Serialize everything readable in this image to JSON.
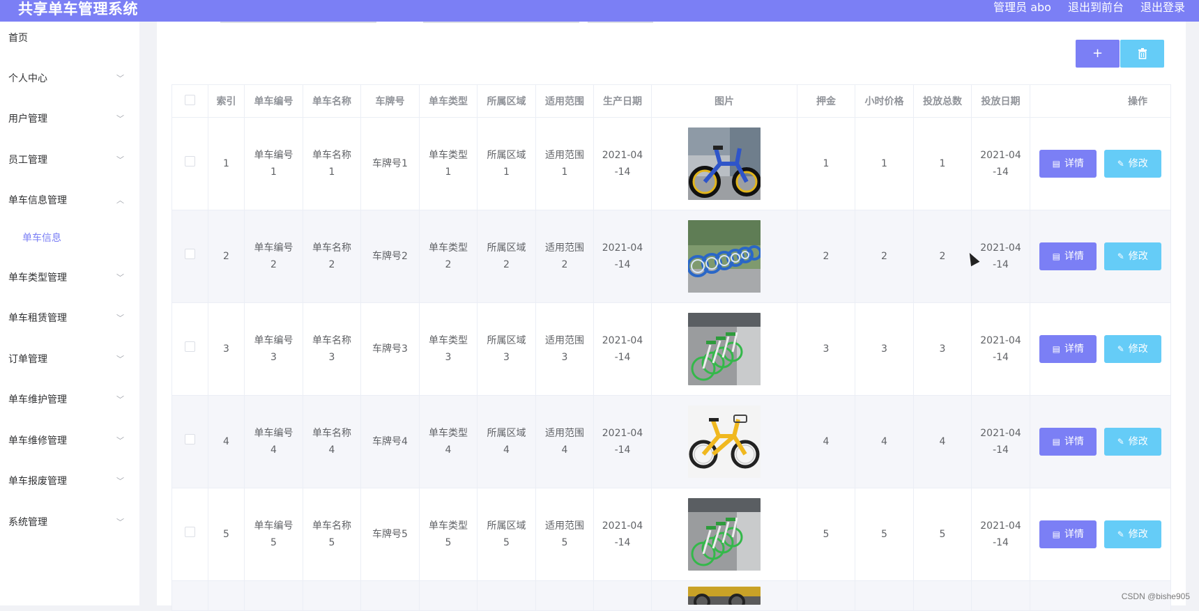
{
  "header": {
    "app_title": "共享单车管理系统",
    "user": "管理员 abo",
    "front_link": "退出到前台",
    "logout": "退出登录"
  },
  "sidebar": {
    "items": [
      {
        "label": "首页",
        "chevron": ""
      },
      {
        "label": "个人中心",
        "chevron": "chevron-down"
      },
      {
        "label": "用户管理",
        "chevron": "chevron-down"
      },
      {
        "label": "员工管理",
        "chevron": "chevron-down"
      },
      {
        "label": "单车信息管理",
        "chevron": "chevron-up"
      },
      {
        "label": "单车信息",
        "chevron": ""
      },
      {
        "label": "单车类型管理",
        "chevron": "chevron-down"
      },
      {
        "label": "单车租赁管理",
        "chevron": "chevron-down"
      },
      {
        "label": "订单管理",
        "chevron": "chevron-down"
      },
      {
        "label": "单车维护管理",
        "chevron": "chevron-down"
      },
      {
        "label": "单车维修管理",
        "chevron": "chevron-down"
      },
      {
        "label": "单车报废管理",
        "chevron": "chevron-down"
      },
      {
        "label": "系统管理",
        "chevron": "chevron-down"
      }
    ]
  },
  "toolbar": {
    "add_icon": "plus-icon",
    "add_label": "+",
    "delete_icon": "trash-icon"
  },
  "table": {
    "columns": [
      "索引",
      "单车编号",
      "单车名称",
      "车牌号",
      "单车类型",
      "所属区域",
      "适用范围",
      "生产日期",
      "图片",
      "押金",
      "小时价格",
      "投放总数",
      "投放日期",
      "操作"
    ],
    "rows": [
      {
        "index": "1",
        "code": "单车编号\n1",
        "name": "单车名称\n1",
        "plate": "车牌号1",
        "type": "单车类型\n1",
        "area": "所属区域\n1",
        "scope": "适用范围\n1",
        "prod_date": "2021-04\n-14",
        "image": "blue-bike-photo",
        "deposit": "1",
        "hour_price": "1",
        "total": "1",
        "launch_date": "2021-04\n-14"
      },
      {
        "index": "2",
        "code": "单车编号\n2",
        "name": "单车名称\n2",
        "plate": "车牌号2",
        "type": "单车类型\n2",
        "area": "所属区域\n2",
        "scope": "适用范围\n2",
        "prod_date": "2021-04\n-14",
        "image": "blue-bike-row-photo",
        "deposit": "2",
        "hour_price": "2",
        "total": "2",
        "launch_date": "2021-04\n-14"
      },
      {
        "index": "3",
        "code": "单车编号\n3",
        "name": "单车名称\n3",
        "plate": "车牌号3",
        "type": "单车类型\n3",
        "area": "所属区域\n3",
        "scope": "适用范围\n3",
        "prod_date": "2021-04\n-14",
        "image": "green-bikes-photo",
        "deposit": "3",
        "hour_price": "3",
        "total": "3",
        "launch_date": "2021-04\n-14"
      },
      {
        "index": "4",
        "code": "单车编号\n4",
        "name": "单车名称\n4",
        "plate": "车牌号4",
        "type": "单车类型\n4",
        "area": "所属区域\n4",
        "scope": "适用范围\n4",
        "prod_date": "2021-04\n-14",
        "image": "yellow-bike-photo",
        "deposit": "4",
        "hour_price": "4",
        "total": "4",
        "launch_date": "2021-04\n-14"
      },
      {
        "index": "5",
        "code": "单车编号\n5",
        "name": "单车名称\n5",
        "plate": "车牌号5",
        "type": "单车类型\n5",
        "area": "所属区域\n5",
        "scope": "适用范围\n5",
        "prod_date": "2021-04\n-14",
        "image": "green-bikes-photo",
        "deposit": "5",
        "hour_price": "5",
        "total": "5",
        "launch_date": "2021-04\n-14"
      }
    ],
    "detail_label": "详情",
    "edit_label": "修改",
    "detail_icon": "document-icon",
    "edit_icon": "pencil-icon"
  },
  "watermark": "CSDN @bishe905",
  "colors": {
    "accent": "#7b7ff5",
    "edit": "#65ccf7",
    "row_alt": "#f5f6fa"
  }
}
